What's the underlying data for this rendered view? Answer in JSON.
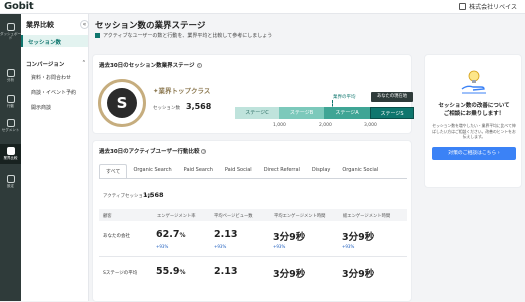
{
  "app": {
    "logo": "Gobit",
    "company": "株式会社リベイス"
  },
  "rail": [
    {
      "icon": "dashboard-icon",
      "label": "ダッシュボード"
    },
    {
      "icon": "chart-icon",
      "label": "分析"
    },
    {
      "icon": "action-icon",
      "label": "行動"
    },
    {
      "icon": "segment-icon",
      "label": "セグメント"
    },
    {
      "icon": "industry-icon",
      "label": "業界比較"
    },
    {
      "icon": "settings-icon",
      "label": "設定"
    }
  ],
  "subnav": {
    "title": "業界比較",
    "active": "セッション数",
    "section": "コンバージョン",
    "items": [
      "資料・お問合わせ",
      "商談・イベント予約",
      "開示商談"
    ]
  },
  "header": {
    "title": "セッション数の業界ステージ",
    "description": "アクティブなユーザーの数と行動を、業界平均と比較して参考にしましょう"
  },
  "stage_card": {
    "title": "過去30日のセッション数業界ステージ",
    "grade": "S",
    "rank_label": "業界トップクラス",
    "session_label": "セッション数",
    "session_value": "3,568",
    "avg_label": "業界の平均",
    "you_label": "あなたの現在地",
    "stages": [
      "ステージC",
      "ステージB",
      "ステージA",
      "ステージS"
    ],
    "ticks": [
      "1,000",
      "2,000",
      "3,000"
    ]
  },
  "behavior_card": {
    "title": "過去30日のアクティブユーザー行動比較",
    "tabs": [
      "すべて",
      "Organic Search",
      "Paid Search",
      "Paid Social",
      "Direct Referral",
      "Display",
      "Organic Social"
    ],
    "active_label": "アクティブセッション数",
    "active_value": "1,568",
    "columns": [
      "顧客",
      "エンゲージメント率",
      "平均ページビュー数",
      "平均エンゲージメント時間",
      "総エンゲージメント時間"
    ],
    "rows": [
      {
        "label": "あなたの会社",
        "engagement": "62.7",
        "engagement_unit": "%",
        "eng_sub": "+93%",
        "pv": "2.13",
        "pv_sub": "+93%",
        "avg_time": "3分9秒",
        "avg_sub": "+93%",
        "total_time": "3分9秒",
        "total_sub": "+93%"
      },
      {
        "label": "Sステージの平均",
        "engagement": "55.9",
        "engagement_unit": "%",
        "pv": "2.13",
        "avg_time": "3分9秒",
        "total_time": "3分9秒"
      }
    ]
  },
  "cta": {
    "title": "セッション数の改善について\nご相談にお乗りします！",
    "description": "セッション数を増やしたい・業界平均に比べて伸ばしたい方はご相談ください。改善のヒントをお伝えします。",
    "button": "対策のご相談はこちら"
  },
  "colors": {
    "stageC": "#bfe3dc",
    "stageB": "#7cc9bb",
    "stageA": "#3fa595",
    "stageS": "#0f766e",
    "brand": "#0f766e",
    "cta": "#3b82f6"
  }
}
